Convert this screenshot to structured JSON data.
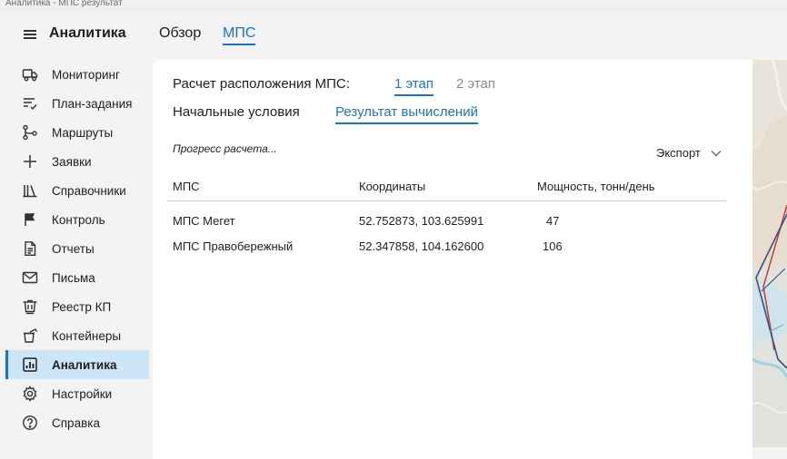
{
  "window": {
    "title": "Аналитика - МПС результат"
  },
  "header": {
    "app_title": "Аналитика",
    "tabs": [
      {
        "label": "Обзор",
        "active": false
      },
      {
        "label": "МПС",
        "active": true
      }
    ]
  },
  "sidebar": {
    "items": [
      {
        "label": "Мониторинг",
        "icon": "truck-icon"
      },
      {
        "label": "План-задания",
        "icon": "checklist-icon"
      },
      {
        "label": "Маршруты",
        "icon": "route-icon"
      },
      {
        "label": "Заявки",
        "icon": "plus-icon"
      },
      {
        "label": "Справочники",
        "icon": "library-icon"
      },
      {
        "label": "Контроль",
        "icon": "flag-icon"
      },
      {
        "label": "Отчеты",
        "icon": "report-icon"
      },
      {
        "label": "Письма",
        "icon": "mail-icon"
      },
      {
        "label": "Реестр КП",
        "icon": "bin-icon"
      },
      {
        "label": "Контейнеры",
        "icon": "container-icon"
      },
      {
        "label": "Аналитика",
        "icon": "analytics-icon",
        "active": true
      },
      {
        "label": "Настройки",
        "icon": "gear-icon"
      },
      {
        "label": "Справка",
        "icon": "help-icon"
      }
    ]
  },
  "panel": {
    "title": "Расчет расположения МПС:",
    "stages": [
      {
        "label": "1 этап",
        "active": true
      },
      {
        "label": "2 этап",
        "active": false
      }
    ],
    "subtabs": [
      {
        "label": "Начальные условия",
        "active": false
      },
      {
        "label": "Результат вычислений",
        "active": true
      }
    ],
    "progress_text": "Прогресс расчета...",
    "export_label": "Экспорт",
    "table": {
      "columns": [
        "МПС",
        "Координаты",
        "Мощность, тонн/день"
      ],
      "rows": [
        [
          "МПС Мегет",
          "52.752873, 103.625991",
          "47"
        ],
        [
          "МПС Правобережный",
          "52.347858, 104.162600",
          "106"
        ]
      ]
    }
  },
  "colors": {
    "accent": "#1a73c9",
    "active_bg": "#cde6f7"
  }
}
